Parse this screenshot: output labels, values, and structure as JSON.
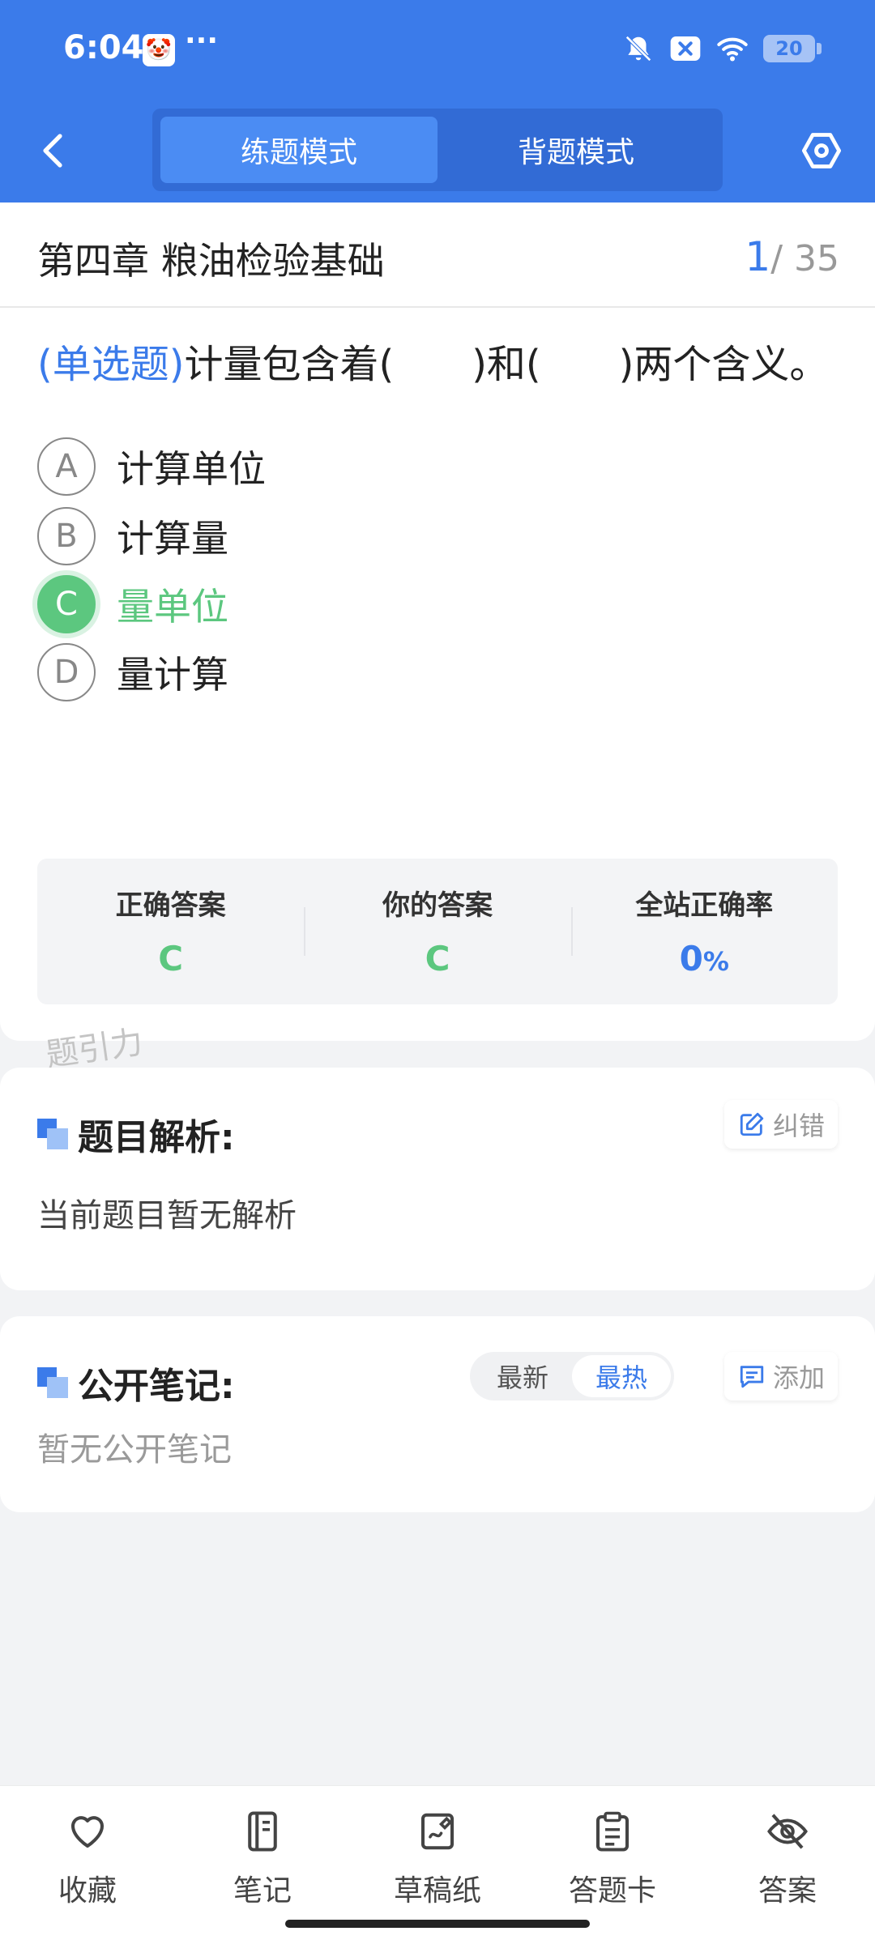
{
  "status_bar": {
    "time": "6:04",
    "more": "···",
    "battery": "20"
  },
  "nav": {
    "tabs": [
      {
        "label": "练题模式",
        "active": true
      },
      {
        "label": "背题模式",
        "active": false
      }
    ]
  },
  "chapter": {
    "title": "第四章 粮油检验基础",
    "current": "1",
    "total": "/ 35"
  },
  "question": {
    "type": "(单选题)",
    "text": "计量包含着(　　)和(　　)两个含义。",
    "options": [
      {
        "letter": "A",
        "text": "计算单位"
      },
      {
        "letter": "B",
        "text": "计算量"
      },
      {
        "letter": "C",
        "text": "量单位",
        "state": "correct"
      },
      {
        "letter": "D",
        "text": "量计算"
      }
    ]
  },
  "answer_summary": {
    "correct_label": "正确答案",
    "correct_value": "C",
    "yours_label": "你的答案",
    "yours_value": "C",
    "rate_label": "全站正确率",
    "rate_value": "0",
    "rate_unit": "%"
  },
  "watermark": "题引力",
  "analysis": {
    "title": "题目解析:",
    "report_label": "纠错",
    "content": "当前题目暂无解析"
  },
  "notes": {
    "title": "公开笔记:",
    "sort_options": [
      "最新",
      "最热"
    ],
    "active_sort": "最热",
    "add_label": "添加",
    "empty_text": "暂无公开笔记"
  },
  "bottom_bar": {
    "items": [
      {
        "label": "收藏",
        "icon": "heart-icon"
      },
      {
        "label": "笔记",
        "icon": "notebook-icon"
      },
      {
        "label": "草稿纸",
        "icon": "draft-icon"
      },
      {
        "label": "答题卡",
        "icon": "clipboard-icon"
      },
      {
        "label": "答案",
        "icon": "eye-off-icon"
      }
    ]
  },
  "colors": {
    "primary": "#3b7bea",
    "correct": "#5cc77f"
  }
}
